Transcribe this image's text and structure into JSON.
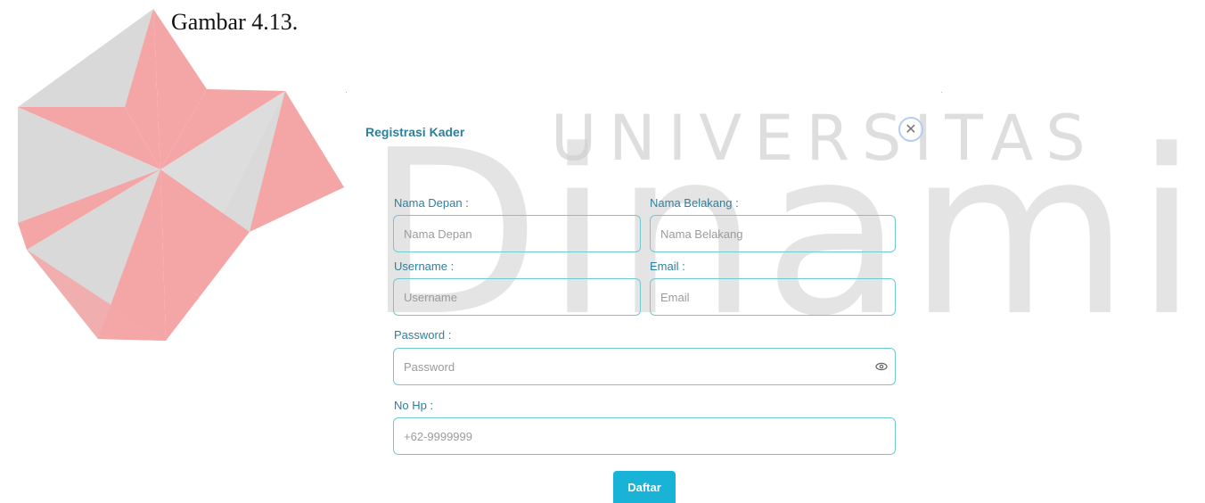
{
  "caption": "Gambar 4.13.",
  "watermark": {
    "top": "UNIVERSITAS",
    "main": "Dinamika"
  },
  "modal": {
    "title": "Registrasi Kader",
    "close_icon": "close-icon",
    "fields": {
      "first_name": {
        "label": "Nama Depan :",
        "placeholder": "Nama Depan"
      },
      "last_name": {
        "label": "Nama Belakang :",
        "placeholder": "Nama Belakang"
      },
      "username": {
        "label": "Username :",
        "placeholder": "Username"
      },
      "email": {
        "label": "Email :",
        "placeholder": "Email"
      },
      "password": {
        "label": "Password :",
        "placeholder": "Password",
        "icon": "eye-icon"
      },
      "phone": {
        "label": "No Hp :",
        "placeholder": "+62-9999999"
      }
    },
    "submit_label": "Daftar"
  },
  "colors": {
    "accent": "#1ab3d8",
    "label": "#2f7f9e",
    "field_border": "#6fc9d2",
    "logo_red": "#f4a3a3",
    "logo_gray": "#d8d8d8"
  }
}
